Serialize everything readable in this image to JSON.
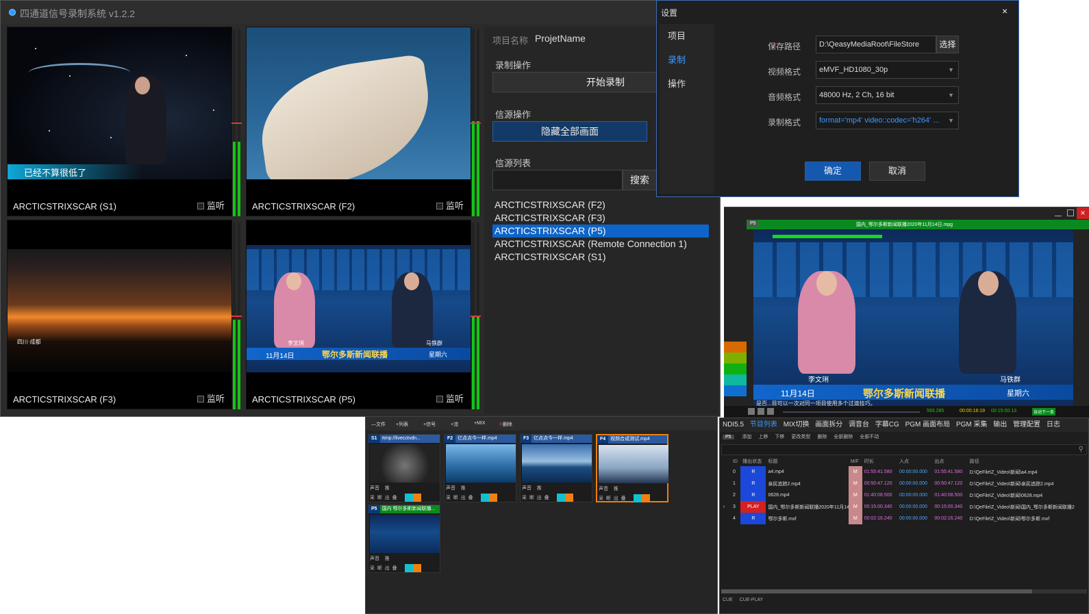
{
  "main_window": {
    "title": "四通道信号录制系统 v1.2.2",
    "cells": [
      {
        "caption": "ARCTICSTRIXSCAR (S1)",
        "monitor": "监听",
        "subtitle": "已经不算很低了"
      },
      {
        "caption": "ARCTICSTRIXSCAR (F2)",
        "monitor": "监听"
      },
      {
        "caption": "ARCTICSTRIXSCAR (F3)",
        "monitor": "监听",
        "overlay": "四川·成都"
      },
      {
        "caption": "ARCTICSTRIXSCAR (P5)",
        "monitor": "监听",
        "news_left": "李文琍",
        "news_right": "马铁群",
        "news_date": "11月14日",
        "news_title": "鄂尔多斯新闻联播",
        "news_day": "星期六"
      }
    ],
    "meters": [
      0.4,
      0.38,
      0.42,
      0.41
    ],
    "side": {
      "project_label": "项目名称",
      "project_value": "ProjetName",
      "record_section": "录制操作",
      "start_record": "开始录制",
      "source_section": "信源操作",
      "hide_all": "隐藏全部画面",
      "source_list_section": "信源列表",
      "search": "搜索",
      "sources": [
        "ARCTICSTRIXSCAR (F2)",
        "ARCTICSTRIXSCAR (F3)",
        "ARCTICSTRIXSCAR (P5)",
        "ARCTICSTRIXSCAR (Remote Connection 1)",
        "ARCTICSTRIXSCAR (S1)"
      ],
      "selected_index": 2
    }
  },
  "settings": {
    "title": "设置",
    "close": "×",
    "nav": [
      "项目",
      "录制",
      "操作"
    ],
    "active_nav": 1,
    "fields": [
      {
        "label": "保存路径",
        "value": "D:\\QeasyMediaRoot\\FileStore",
        "button": "选择",
        "required": "*"
      },
      {
        "label": "视频格式",
        "value": "eMVF_HD1080_30p"
      },
      {
        "label": "音频格式",
        "value": "48000 Hz, 2 Ch, 16  bit"
      },
      {
        "label": "录制格式",
        "value": "format='mp4' video::codec='h264' ..."
      }
    ],
    "ok": "确定",
    "cancel": "取消"
  },
  "preview": {
    "tag": "P5",
    "file": "国内_鄂尔多斯新闻联播2020年11月14日.mpg",
    "news_left": "李文琍",
    "news_right": "马铁群",
    "news_date": "11月14日",
    "news_title": "鄂尔多斯新闻联播",
    "news_day": "星期六",
    "ticker": "是否...目可以一次对同一项目使用多个过渡技巧。",
    "time_current": "00:00:18:19",
    "time_total": "00:15:00:13",
    "time_left": "593.285",
    "status": "自动下一条"
  },
  "media": {
    "toolbar": [
      "文件",
      "列表",
      "信号",
      "流",
      "MIX",
      "删除"
    ],
    "clips": [
      {
        "tag": "S1",
        "name": "rtmp://livecctvdn..."
      },
      {
        "tag": "F2",
        "name": "亿点点今一样.mp4"
      },
      {
        "tag": "F3",
        "name": "亿点点今一样.mp4"
      },
      {
        "tag": "F4",
        "name": "视频合成测试.mp4"
      },
      {
        "tag": "P5",
        "name": "国内 鄂尔多斯新闻联播..."
      }
    ],
    "row1": [
      "声音",
      "推"
    ],
    "row2": [
      "采",
      "断",
      "出",
      "叠"
    ]
  },
  "playlist": {
    "tabs": [
      "NDI5.5",
      "节目列表",
      "MIX切换",
      "画面拆分",
      "调音台",
      "字幕CG",
      "PGM 画面布局",
      "PGM 采集",
      "输出",
      "管理配置",
      "日志"
    ],
    "active_tab": 1,
    "subtoolbar": [
      "P5",
      "添加",
      "上移",
      "下移",
      "更改类型",
      "删除",
      "全部删除",
      "全部不动"
    ],
    "headers": [
      "ID",
      "播出状态",
      "标题",
      "M/F",
      "时长",
      "入点",
      "出点",
      "路径"
    ],
    "rows": [
      {
        "id": "0",
        "status": "R",
        "title": "a4.mp4",
        "mf": "M",
        "dur": "01:55:41.580",
        "in": "00:00:00.000",
        "out": "01:55:41.580",
        "path": "D:\\QeFile\\Z_Video\\新闻\\a4.mp4"
      },
      {
        "id": "1",
        "status": "R",
        "title": "亲民追踪2.mp4",
        "mf": "M",
        "dur": "00:50:47.120",
        "in": "00:00:00.000",
        "out": "00:50:47.120",
        "path": "D:\\QeFile\\Z_Video\\新闻\\亲民追踪2.mp4"
      },
      {
        "id": "2",
        "status": "R",
        "title": "0628.mp4",
        "mf": "M",
        "dur": "01:40:08.500",
        "in": "00:00:00.000",
        "out": "01:40:08.500",
        "path": "D:\\QeFile\\Z_Video\\新闻\\0628.mp4"
      },
      {
        "id": "3",
        "status": "PLAY",
        "title": "国内_鄂尔多斯新闻联播2020年11月14日.mpg",
        "mf": "M",
        "dur": "00:15:00.340",
        "in": "00:00:00.000",
        "out": "00:15:00.340",
        "path": "D:\\QeFile\\Z_Video\\新闻\\国内_鄂尔多斯新闻联播2"
      },
      {
        "id": "4",
        "status": "R",
        "title": "鄂尔多斯.mxf",
        "mf": "M",
        "dur": "00:02:16.240",
        "in": "00:00:00.000",
        "out": "00:02:16.240",
        "path": "D:\\QeFile\\Z_Video\\新闻\\鄂尔多斯.mxf"
      }
    ],
    "footer": [
      "CUE",
      "CUE-PLAY"
    ]
  },
  "colors": {
    "accent": "#0e64c8",
    "meter": "#12c712",
    "peak": "#e33333",
    "play": "#d42020"
  }
}
